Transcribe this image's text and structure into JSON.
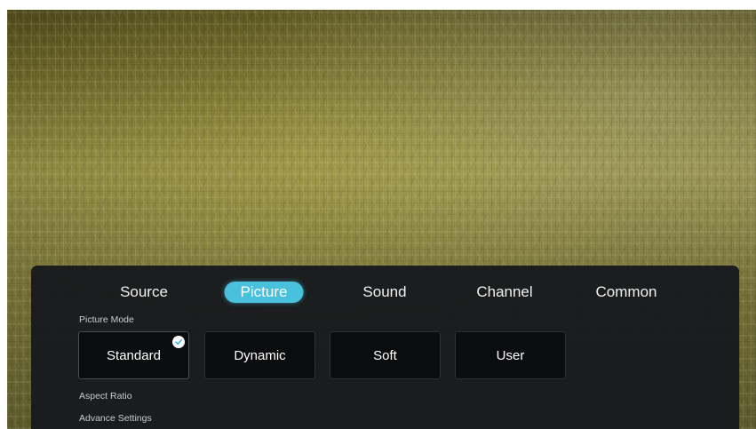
{
  "tabs": [
    {
      "label": "Source"
    },
    {
      "label": "Picture"
    },
    {
      "label": "Sound"
    },
    {
      "label": "Channel"
    },
    {
      "label": "Common"
    }
  ],
  "active_tab": "Picture",
  "picture_mode": {
    "label": "Picture Mode",
    "options": [
      {
        "label": "Standard"
      },
      {
        "label": "Dynamic"
      },
      {
        "label": "Soft"
      },
      {
        "label": "User"
      }
    ],
    "selected": "Standard"
  },
  "aspect_ratio": {
    "label": "Aspect Ratio"
  },
  "advance_settings": {
    "label": "Advance Settings"
  },
  "colors": {
    "accent": "#49c0dc",
    "panel": "#181a1d",
    "card": "#0b0c0e"
  },
  "icons": {
    "selected_marker": "check-icon"
  }
}
